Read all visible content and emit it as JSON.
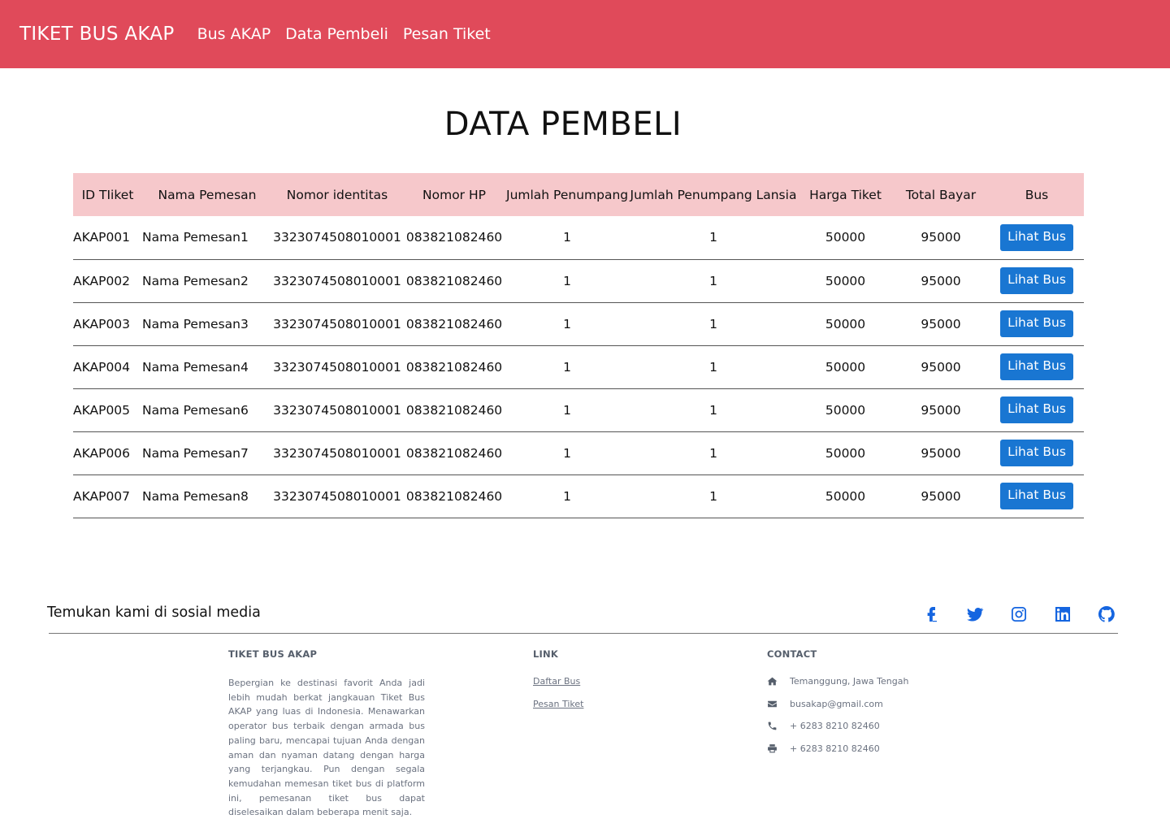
{
  "nav": {
    "brand": "TIKET BUS AKAP",
    "links": [
      "Bus AKAP",
      "Data Pembeli",
      "Pesan Tiket"
    ]
  },
  "page_title": "DATA PEMBELI",
  "table": {
    "headers": [
      "ID TIiket",
      "Nama Pemesan",
      "Nomor identitas",
      "Nomor HP",
      "Jumlah Penumpang",
      "Jumlah Penumpang Lansia",
      "Harga Tiket",
      "Total Bayar",
      "Bus"
    ],
    "button_label": "Lihat Bus",
    "rows": [
      [
        "AKAP001",
        "Nama Pemesan1",
        "3323074508010001",
        "083821082460",
        "1",
        "1",
        "50000",
        "95000"
      ],
      [
        "AKAP002",
        "Nama Pemesan2",
        "3323074508010001",
        "083821082460",
        "1",
        "1",
        "50000",
        "95000"
      ],
      [
        "AKAP003",
        "Nama Pemesan3",
        "3323074508010001",
        "083821082460",
        "1",
        "1",
        "50000",
        "95000"
      ],
      [
        "AKAP004",
        "Nama Pemesan4",
        "3323074508010001",
        "083821082460",
        "1",
        "1",
        "50000",
        "95000"
      ],
      [
        "AKAP005",
        "Nama Pemesan6",
        "3323074508010001",
        "083821082460",
        "1",
        "1",
        "50000",
        "95000"
      ],
      [
        "AKAP006",
        "Nama Pemesan7",
        "3323074508010001",
        "083821082460",
        "1",
        "1",
        "50000",
        "95000"
      ],
      [
        "AKAP007",
        "Nama Pemesan8",
        "3323074508010001",
        "083821082460",
        "1",
        "1",
        "50000",
        "95000"
      ]
    ]
  },
  "footer": {
    "social_text": "Temukan kami di sosial media",
    "social_icons": [
      "facebook-icon",
      "twitter-icon",
      "instagram-icon",
      "linkedin-icon",
      "github-icon"
    ],
    "about": {
      "title": "TIKET BUS AKAP",
      "text": "Bepergian ke destinasi favorit Anda jadi lebih mudah berkat jangkauan Tiket Bus AKAP yang luas di Indonesia. Menawarkan operator bus terbaik dengan armada bus paling baru, mencapai tujuan Anda dengan aman dan nyaman datang dengan harga yang terjangkau. Pun dengan segala kemudahan memesan tiket bus di platform ini, pemesanan tiket bus dapat diselesaikan dalam beberapa menit saja."
    },
    "links": {
      "title": "LINK",
      "items": [
        "Daftar Bus",
        "Pesan Tiket"
      ]
    },
    "contact": {
      "title": "CONTACT",
      "address": "Temanggung, Jawa Tengah",
      "email": "busakap@gmail.com",
      "phone": "+ 6283 8210 82460",
      "fax": "+ 6283 8210 82460"
    }
  },
  "colors": {
    "navbar": "#e04a5a",
    "table_header": "#f6c8cb",
    "button": "#1976d2",
    "social_icon": "#1565e0"
  }
}
